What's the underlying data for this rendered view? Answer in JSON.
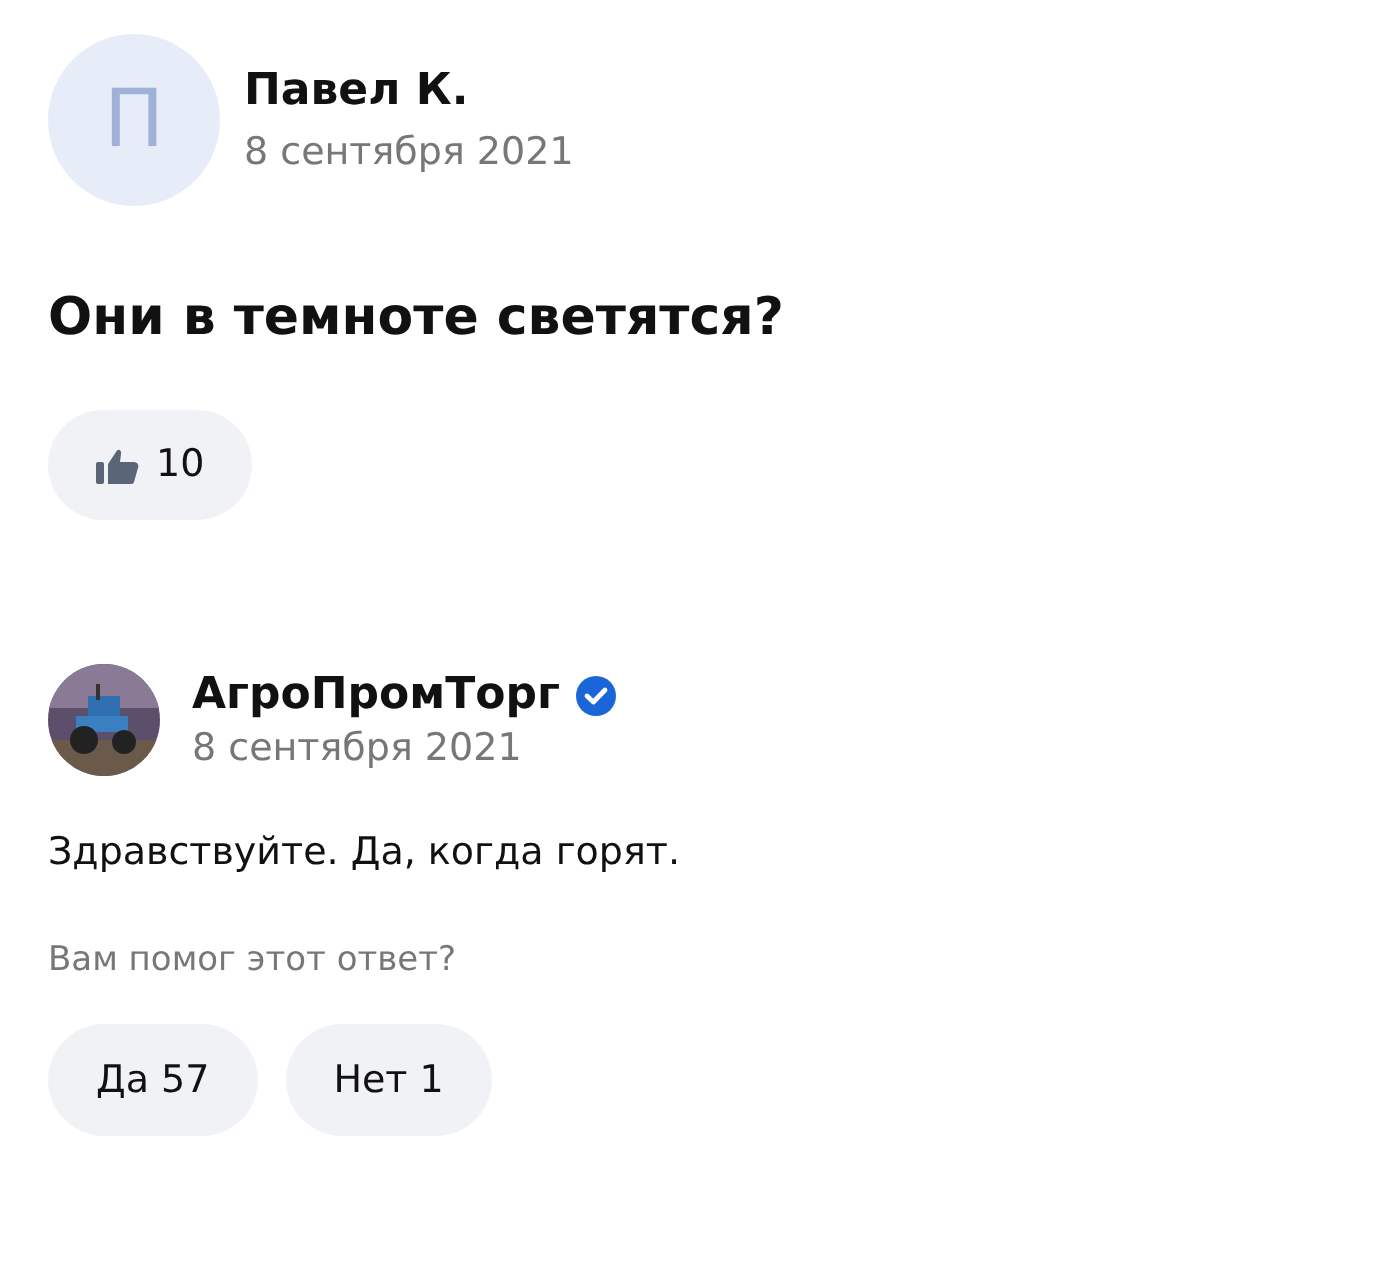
{
  "question": {
    "author": {
      "initial": "П",
      "name": "Павел К."
    },
    "date": "8 сентября 2021",
    "text": "Они в темноте светятся?",
    "likes": "10"
  },
  "answer": {
    "author": {
      "name": "АгроПромТорг",
      "verified": true
    },
    "date": "8 сентября 2021",
    "text": "Здравствуйте. Да, когда горят.",
    "feedback_prompt": "Вам помог этот ответ?",
    "feedback_buttons": [
      {
        "label": "Да 57"
      },
      {
        "label": "Нет 1"
      }
    ]
  }
}
